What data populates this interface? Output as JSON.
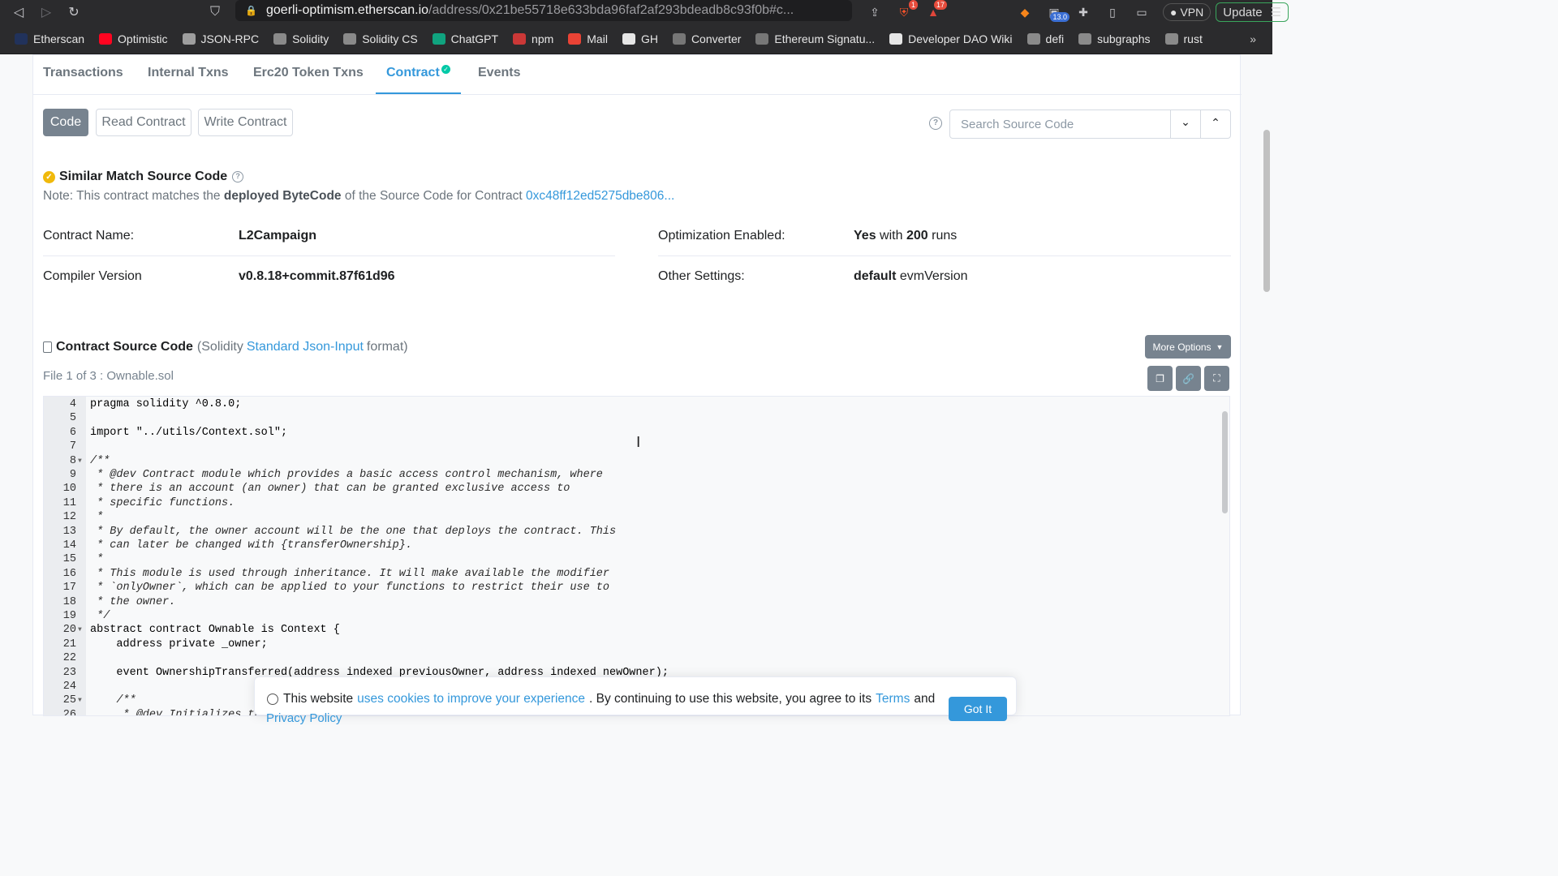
{
  "browser": {
    "url_host": "goerli-optimism.etherscan.io",
    "url_path": "/address/0x21be55718e633bda96faf2af293bdeadb8c93f0b#c...",
    "badge_brave": "1",
    "badge_alerts": "17",
    "badge_meta": "13.0",
    "vpn_label": "VPN",
    "update_label": "Update",
    "bookmarks": [
      {
        "label": "Etherscan",
        "color": "#21325b"
      },
      {
        "label": "Optimistic",
        "color": "#ff0420"
      },
      {
        "label": "JSON-RPC",
        "color": "#9e9e9e"
      },
      {
        "label": "Solidity",
        "color": "#8a8a8a"
      },
      {
        "label": "Solidity CS",
        "color": "#8a8a8a"
      },
      {
        "label": "ChatGPT",
        "color": "#10a37f"
      },
      {
        "label": "npm",
        "color": "#cb3837"
      },
      {
        "label": "Mail",
        "color": "#ea4335"
      },
      {
        "label": "GH",
        "color": "#e6e6e6"
      },
      {
        "label": "Converter",
        "color": "#777777"
      },
      {
        "label": "Ethereum Signatu...",
        "color": "#777777"
      },
      {
        "label": "Developer DAO Wiki",
        "color": "#e6e6e6"
      },
      {
        "label": "defi",
        "color": "#8a8a8a"
      },
      {
        "label": "subgraphs",
        "color": "#8a8a8a"
      },
      {
        "label": "rust",
        "color": "#8a8a8a"
      }
    ]
  },
  "tabs": [
    "Transactions",
    "Internal Txns",
    "Erc20 Token Txns",
    "Contract",
    "Events"
  ],
  "subtabs": {
    "code": "Code",
    "read": "Read Contract",
    "write": "Write Contract"
  },
  "search": {
    "placeholder": "Search Source Code"
  },
  "match": {
    "title": "Similar Match Source Code",
    "note_prefix": "Note: This contract matches the",
    "note_bold": "deployed ByteCode",
    "note_mid": "of the Source Code for Contract",
    "note_link": "0xc48ff12ed5275dbe806..."
  },
  "info": {
    "contract_name_label": "Contract Name:",
    "contract_name": "L2Campaign",
    "compiler_label": "Compiler Version",
    "compiler": "v0.8.18+commit.87f61d96",
    "optimization_label": "Optimization Enabled:",
    "optimization_yes": "Yes",
    "optimization_with": "with",
    "optimization_runs": "200",
    "optimization_runs_word": "runs",
    "other_label": "Other Settings:",
    "other_bold": "default",
    "other_rest": "evmVersion"
  },
  "source": {
    "title": "Contract Source Code",
    "fmt_prefix": "(Solidity",
    "fmt_link": "Standard Json-Input",
    "fmt_suffix": "format)",
    "more_options": "More Options",
    "file_label": "File 1 of 3 : Ownable.sol"
  },
  "code_lines": [
    {
      "n": "4",
      "t": "pragma solidity ^0.8.0;",
      "c": false,
      "f": false
    },
    {
      "n": "5",
      "t": "",
      "c": false,
      "f": false
    },
    {
      "n": "6",
      "t": "import \"../utils/Context.sol\";",
      "c": false,
      "f": false
    },
    {
      "n": "7",
      "t": "",
      "c": false,
      "f": false
    },
    {
      "n": "8",
      "t": "/**",
      "c": true,
      "f": true
    },
    {
      "n": "9",
      "t": " * @dev Contract module which provides a basic access control mechanism, where",
      "c": true,
      "f": false
    },
    {
      "n": "10",
      "t": " * there is an account (an owner) that can be granted exclusive access to",
      "c": true,
      "f": false
    },
    {
      "n": "11",
      "t": " * specific functions.",
      "c": true,
      "f": false
    },
    {
      "n": "12",
      "t": " *",
      "c": true,
      "f": false
    },
    {
      "n": "13",
      "t": " * By default, the owner account will be the one that deploys the contract. This",
      "c": true,
      "f": false
    },
    {
      "n": "14",
      "t": " * can later be changed with {transferOwnership}.",
      "c": true,
      "f": false
    },
    {
      "n": "15",
      "t": " *",
      "c": true,
      "f": false
    },
    {
      "n": "16",
      "t": " * This module is used through inheritance. It will make available the modifier",
      "c": true,
      "f": false
    },
    {
      "n": "17",
      "t": " * `onlyOwner`, which can be applied to your functions to restrict their use to",
      "c": true,
      "f": false
    },
    {
      "n": "18",
      "t": " * the owner.",
      "c": true,
      "f": false
    },
    {
      "n": "19",
      "t": " */",
      "c": true,
      "f": false
    },
    {
      "n": "20",
      "t": "abstract contract Ownable is Context {",
      "c": false,
      "f": true
    },
    {
      "n": "21",
      "t": "    address private _owner;",
      "c": false,
      "f": false
    },
    {
      "n": "22",
      "t": "",
      "c": false,
      "f": false
    },
    {
      "n": "23",
      "t": "    event OwnershipTransferred(address indexed previousOwner, address indexed newOwner);",
      "c": false,
      "f": false
    },
    {
      "n": "24",
      "t": "",
      "c": false,
      "f": false
    },
    {
      "n": "25",
      "t": "    /**",
      "c": true,
      "f": true
    },
    {
      "n": "26",
      "t": "     * @dev Initializes th",
      "c": true,
      "f": false
    }
  ],
  "cookie": {
    "prefix": "This website",
    "link1": "uses cookies to improve your experience",
    "mid": ". By continuing to use this website, you agree to its",
    "link2": "Terms",
    "suffix": "and",
    "line2": "Privacy Policy",
    "button": "Got It"
  }
}
